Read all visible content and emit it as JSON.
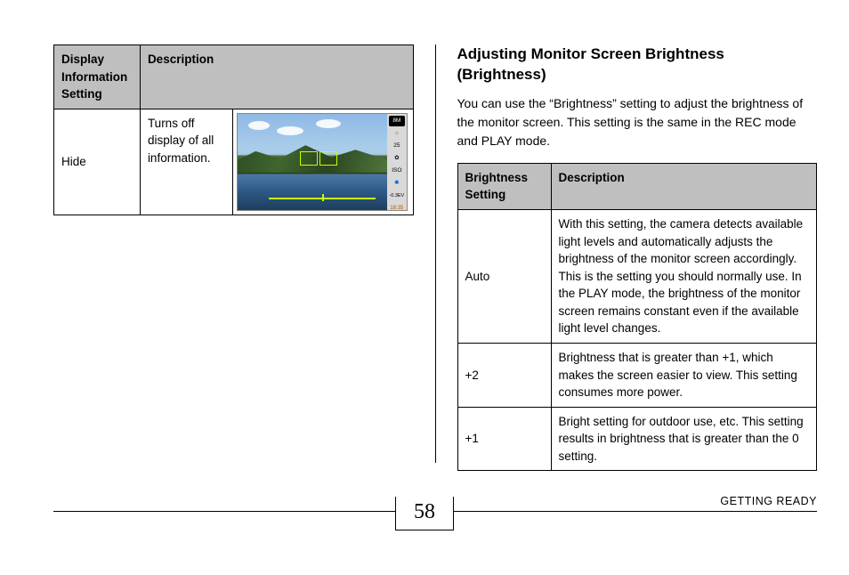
{
  "page_number": "58",
  "footer_section": "GETTING READY",
  "left": {
    "table": {
      "header1": "Display Information Setting",
      "header2": "Description",
      "row": {
        "setting": "Hide",
        "description": "Turns off display of all information."
      }
    },
    "camera_sidebar": {
      "i1": "8M",
      "i2": "☼",
      "i3": "25",
      "i4": "✿",
      "i5": "ISO",
      "i6": "✱",
      "i7": "-0.3EV",
      "i8": "18:35"
    }
  },
  "right": {
    "heading": "Adjusting Monitor Screen Brightness (Brightness)",
    "intro": "You can use the “Brightness” setting to adjust the brightness of the monitor screen. This setting is the same in the REC mode and PLAY mode.",
    "table": {
      "header1": "Brightness Setting",
      "header2": "Description",
      "rows": [
        {
          "setting": "Auto",
          "description": "With this setting, the camera detects available light levels and automatically adjusts the brightness of the monitor screen accordingly. This is the setting you should normally use.\nIn the PLAY mode, the brightness of the monitor screen remains constant even if the available light level changes."
        },
        {
          "setting": "+2",
          "description": "Brightness that is greater than +1, which makes the screen easier to view. This setting consumes more power."
        },
        {
          "setting": "+1",
          "description": "Bright setting for outdoor use, etc. This setting results in brightness that is greater than the 0 setting."
        }
      ]
    }
  }
}
